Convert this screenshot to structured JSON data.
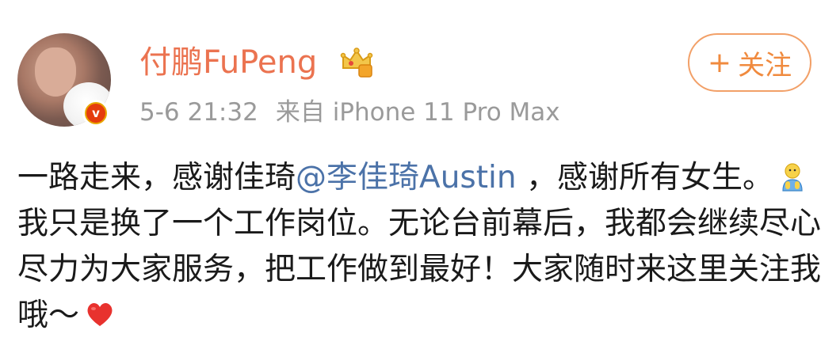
{
  "post": {
    "username": "付鹏FuPeng",
    "time": "5-6 21:32",
    "source_prefix": "来自",
    "source_device": "iPhone 11 Pro Max",
    "follow_label": "关注",
    "follow_plus": "+",
    "badge_letter": "v",
    "text": {
      "p1": "一路走来，感谢佳琦",
      "mention": "@李佳琦Austin",
      "p2": " ，感谢所有女生。",
      "p3": "我只是换了一个工作岗位。无论台前幕后，我都会继续尽心尽力为大家服务，把工作做到最好！大家随时来这里关注我哦～"
    },
    "icons": {
      "badge": "verified-v-icon",
      "crown": "crown-level-icon",
      "emoji_1": "person-emoji-icon",
      "emoji_2": "heart-emoji-icon"
    },
    "colors": {
      "username": "#eb7350",
      "mention": "#4b72a8",
      "follow": "#f08a3e"
    }
  }
}
